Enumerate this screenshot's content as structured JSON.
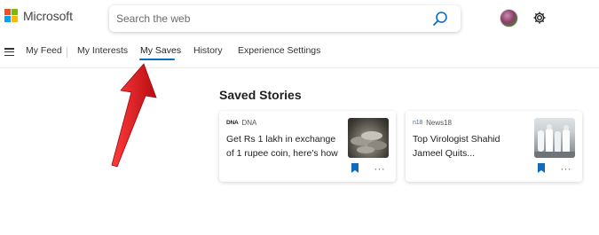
{
  "brand": {
    "name": "Microsoft",
    "colors": [
      "#f25022",
      "#7fba00",
      "#00a4ef",
      "#ffb900"
    ]
  },
  "search": {
    "placeholder": "Search the web"
  },
  "nav": {
    "items": [
      {
        "label": "My Feed"
      },
      {
        "label": "My Interests"
      },
      {
        "label": "My Saves",
        "active": true
      },
      {
        "label": "History"
      },
      {
        "label": "Experience Settings"
      }
    ]
  },
  "main": {
    "title": "Saved Stories",
    "cards": [
      {
        "source": "DNA",
        "source_logo": "DNA",
        "headline": "Get Rs 1 lakh in exchange of 1 rupee coin, here's how",
        "thumbnail": "coins-photo"
      },
      {
        "source": "News18",
        "source_logo": "n18",
        "headline": "Top Virologist Shahid Jameel Quits...",
        "thumbnail": "people-ppe-photo"
      }
    ],
    "more_symbol": "···"
  },
  "annotation": {
    "type": "red-arrow",
    "points_to": "My Saves",
    "color": "#e3161b"
  },
  "accent": "#0f6cbd"
}
